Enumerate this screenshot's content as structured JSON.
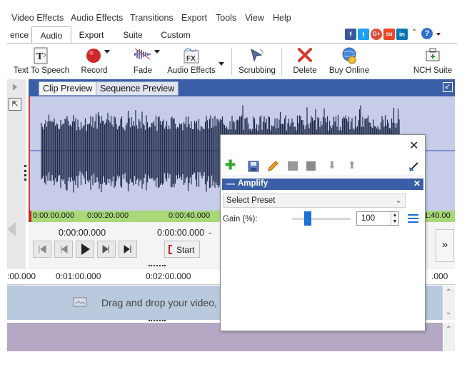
{
  "menu": [
    "Video Effects",
    "Audio Effects",
    "Transitions",
    "Export",
    "Tools",
    "View",
    "Help"
  ],
  "tabs": [
    "ence",
    "Audio",
    "Export",
    "Suite",
    "Custom"
  ],
  "active_tab": "Audio",
  "social": [
    {
      "name": "facebook-icon",
      "glyph": "f",
      "color": "#3b5998"
    },
    {
      "name": "twitter-icon",
      "glyph": "t",
      "color": "#1da1f2"
    },
    {
      "name": "google-plus-icon",
      "glyph": "G+",
      "color": "#dd4b39"
    },
    {
      "name": "stumbleupon-icon",
      "glyph": "su",
      "color": "#eb4924"
    },
    {
      "name": "linkedin-icon",
      "glyph": "in",
      "color": "#0077b5"
    }
  ],
  "toolbar": {
    "text_to_speech": "Text To Speech",
    "record": "Record",
    "fade": "Fade",
    "audio_effects": "Audio Effects",
    "scrubbing": "Scrubbing",
    "delete": "Delete",
    "buy_online": "Buy Online",
    "nch_suite": "NCH Suite"
  },
  "preview_tabs": {
    "clip": "Clip Preview",
    "sequence": "Sequence Preview"
  },
  "timeline_labels": [
    "0:00:00.000",
    "0:00:20.000",
    "0:00:40.000",
    "1:40.00"
  ],
  "transport": {
    "time_left": "0:00:00.000",
    "time_right": "0:00:00.000",
    "time_sep": "-",
    "start": "Start"
  },
  "ruler_labels": [
    ":00.000",
    "0:01:00.000",
    "0:02:00.000",
    ".000"
  ],
  "track_hint": "Drag and drop your video,",
  "dialog": {
    "header": "Amplify",
    "preset_placeholder": "Select Preset",
    "gain_label": "Gain (%):",
    "gain_value": "100",
    "gain_slider_fraction": 0.27
  },
  "colors": {
    "accent_blue": "#3b5ea8",
    "waveform": "#1f2a4a",
    "timeline_green": "#a8d878",
    "record_red": "#cc2a2a",
    "delete_red": "#d33a2a",
    "add_green": "#35a835"
  }
}
